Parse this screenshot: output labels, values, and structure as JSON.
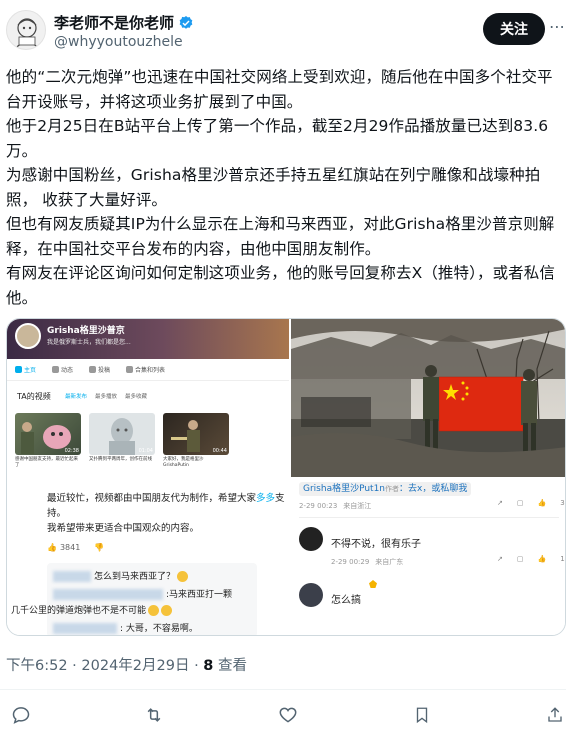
{
  "author": {
    "display_name": "李老师不是你老师",
    "handle": "@whyyoutouzhele",
    "follow_label": "关注"
  },
  "tweet": {
    "paragraphs": [
      "他的“二次元炮弹”也迅速在中国社交网络上受到欢迎，随后他在中国多个社交平台开设账号，并将这项业务扩展到了中国。",
      "他于2月25日在B站平台上传了第一个作品，截至2月29作品播放量已达到83.6万。",
      "为感谢中国粉丝，Grisha格里沙普京还手持五星红旗站在列宁雕像和战壕种拍照， 收获了大量好评。",
      "但也有网友质疑其IP为什么显示在上海和马来西亚，对此Grisha格里沙普京则解释，在中国社交平台发布的内容，由他中国朋友制作。",
      "有网友在评论区询问如何定制这项业务，他的账号回复称去X（推特），或者私信他。"
    ],
    "time": "下午6:52 · 2024年2月29日",
    "views_count": "8",
    "views_label": " 查看"
  },
  "bili_profile": {
    "name": "Grisha格里沙普京",
    "sign": "我是俄罗斯士兵，我们都是您...",
    "tabs": [
      "主页",
      "动态",
      "投稿",
      "合集和列表"
    ],
    "section_title": "TA的视频",
    "sort_options": [
      "最新发布",
      "最多播放",
      "最多收藏"
    ],
    "videos": [
      {
        "duration": "02:38",
        "title": "感谢中国朋友支持，最近忙起来了"
      },
      {
        "duration": "01:04",
        "title": "又扑腾到平两周年，创作在前线"
      },
      {
        "duration": "00:44",
        "title": "大家好，我是格里沙 GrishaPutin"
      }
    ]
  },
  "bili_reply": {
    "line1_pre": "最近较忙，视频都由中国朋友代为制作，希望大家",
    "line1_hl": "多多",
    "line1_post": "支持。",
    "line2": "我希望带来更适合中国观众的内容。",
    "likes": "3841",
    "nested": [
      "怎么到马来西亚了？",
      ":马来西亚打一颗",
      "几千公里的弹道炮弹也不是不可能",
      ": 大哥，不容易啊。"
    ]
  },
  "right_comments": {
    "reply_user": "Grisha格里沙Put1n",
    "reply_text": "：去x，或私聊我",
    "reply_date": "2-29 00:23",
    "reply_loc": "来自浙江",
    "reply_likes": "3",
    "c2_text": "不得不说，很有乐子",
    "c2_date": "2-29 00:29",
    "c2_loc": "来自广东",
    "c2_likes": "14",
    "c3_text": "怎么搞"
  },
  "actions": {
    "reply_icon": "reply-icon",
    "retweet_icon": "retweet-icon",
    "like_icon": "heart-icon",
    "bookmark_icon": "bookmark-icon",
    "share_icon": "share-icon"
  },
  "colors": {
    "follow_bg": "#0f1419",
    "verified": "#1d9bf0",
    "flag_red": "#de2910",
    "bili_blue": "#00aeec"
  }
}
